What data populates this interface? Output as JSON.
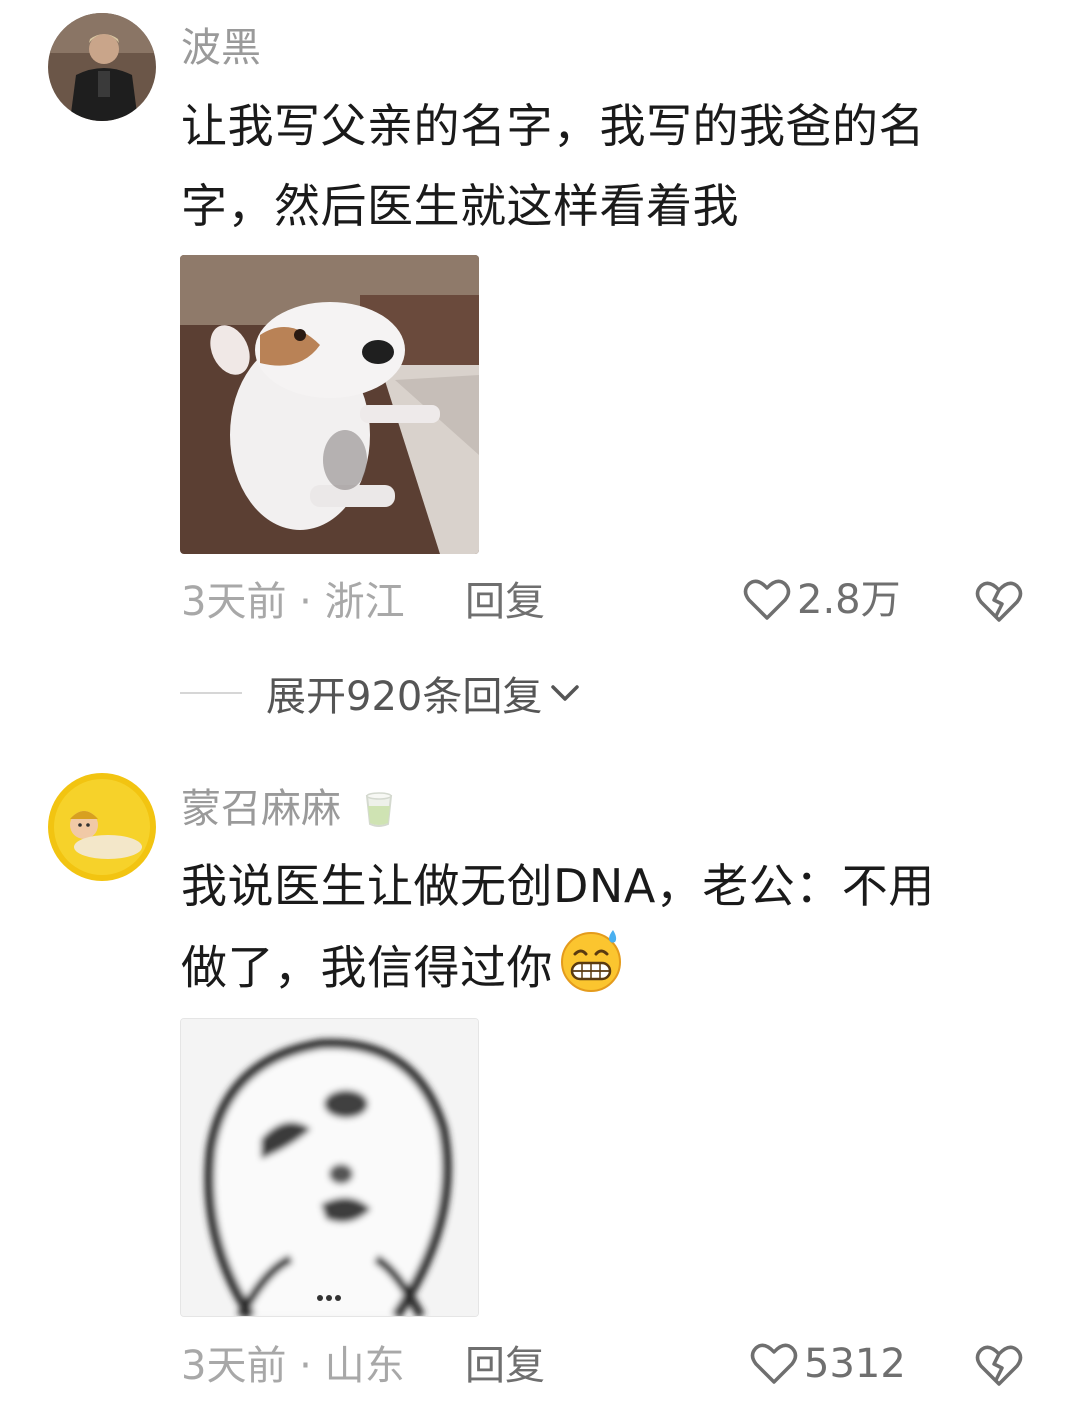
{
  "comments": [
    {
      "username": "波黑",
      "text_line1": "让我写父亲的名字，我写的我爸的名",
      "text_line2": "字，然后医生就这样看着我",
      "time_location": "3天前 · 浙江",
      "reply_label": "回复",
      "likes": "2.8万",
      "avatar_icon": "man-portrait-avatar",
      "image_icon": "dog-meme-image"
    },
    {
      "username": "蒙召麻麻",
      "user_badge_icon": "tea-cup-badge-icon",
      "text_line1": "我说医生让做无创DNA，老公：不用",
      "text_line2": "做了，我信得过你",
      "inline_emoji_icon": "grinning-sweat-emoji",
      "time_location": "3天前 · 山东",
      "reply_label": "回复",
      "likes": "5312",
      "avatar_icon": "baby-yellow-avatar",
      "image_icon": "blurry-face-meme-image"
    }
  ],
  "expand_replies": {
    "label": "展开920条回复"
  },
  "colors": {
    "username": "#9a9a9a",
    "text": "#1a1a1a",
    "meta": "#a8a8a8",
    "action": "#6f6f6f"
  }
}
